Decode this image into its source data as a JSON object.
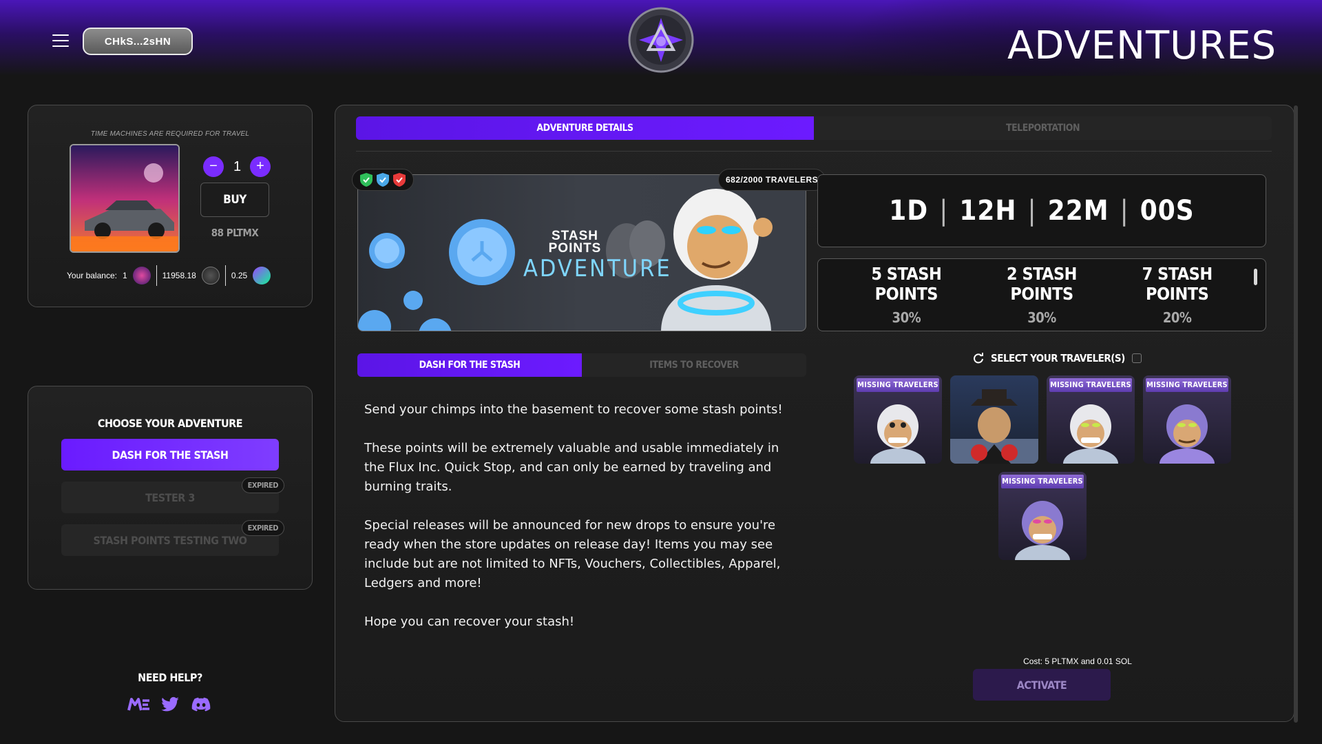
{
  "header": {
    "wallet": "CHkS...2sHN",
    "title": "ADVENTURES"
  },
  "time_machines": {
    "note": "TIME MACHINES ARE REQUIRED FOR TRAVEL",
    "quantity": "1",
    "minus": "−",
    "plus": "+",
    "buy_label": "BUY",
    "price": "88 PLTMX",
    "balance_label": "Your balance:",
    "balance_machines": "1",
    "balance_pltmx": "11958.18",
    "balance_sol": "0.25"
  },
  "adventures": {
    "title": "CHOOSE YOUR ADVENTURE",
    "items": [
      {
        "label": "DASH FOR THE STASH",
        "status": "active",
        "badge": ""
      },
      {
        "label": "TESTER 3",
        "status": "expired",
        "badge": "EXPIRED"
      },
      {
        "label": "STASH POINTS TESTING TWO",
        "status": "expired",
        "badge": "EXPIRED"
      }
    ]
  },
  "help": {
    "title": "NEED HELP?"
  },
  "main": {
    "tabs": [
      {
        "label": "ADVENTURE DETAILS",
        "active": true
      },
      {
        "label": "TELEPORTATION",
        "active": false
      }
    ],
    "banner": {
      "travelers": "682/2000 TRAVELERS",
      "line1": "STASH",
      "line2": "POINTS",
      "line3": "ADVENTURE"
    },
    "timer": {
      "days": "1D",
      "hours": "12H",
      "minutes": "22M",
      "seconds": "00S",
      "sep": "|"
    },
    "rewards": [
      {
        "name": "5 STASH POINTS",
        "pct": "30%"
      },
      {
        "name": "2 STASH POINTS",
        "pct": "30%"
      },
      {
        "name": "7 STASH POINTS",
        "pct": "20%"
      }
    ],
    "subtabs": [
      {
        "label": "DASH FOR THE STASH",
        "active": true
      },
      {
        "label": "ITEMS TO RECOVER",
        "active": false
      }
    ],
    "description": [
      "Send your chimps into the basement to recover some stash points!",
      "These points will be extremely valuable and usable immediately in the Flux Inc. Quick Stop, and can only be earned by traveling and burning traits.",
      "Special releases will be announced for new drops to ensure you're ready when the store updates on release day! Items you may see include but are not limited to NFTs, Vouchers, Collectibles, Apparel, Ledgers and more!",
      "Hope you can recover your stash!"
    ],
    "select_label": "SELECT YOUR TRAVELER(S)",
    "travelers": [
      {
        "poster": "MISSING TRAVELERS"
      },
      {
        "poster": ""
      },
      {
        "poster": "MISSING TRAVELERS"
      },
      {
        "poster": "MISSING TRAVELERS"
      },
      {
        "poster": "MISSING TRAVELERS"
      }
    ],
    "cost": "Cost: 5 PLTMX and 0.01 SOL",
    "activate_label": "ACTIVATE"
  },
  "colors": {
    "accent": "#6a1bff",
    "header_top": "#4a16b8",
    "background": "#161616"
  }
}
